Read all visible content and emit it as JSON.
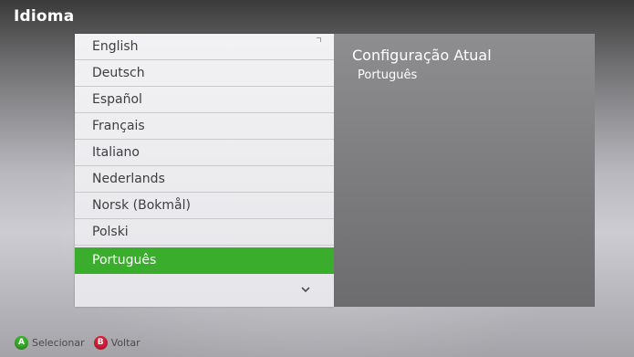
{
  "screen": {
    "title": "Idioma"
  },
  "language_list": {
    "items": [
      {
        "label": "English",
        "selected": false
      },
      {
        "label": "Deutsch",
        "selected": false
      },
      {
        "label": "Español",
        "selected": false
      },
      {
        "label": "Français",
        "selected": false
      },
      {
        "label": "Italiano",
        "selected": false
      },
      {
        "label": "Nederlands",
        "selected": false
      },
      {
        "label": "Norsk (Bokmål)",
        "selected": false
      },
      {
        "label": "Polski",
        "selected": false
      },
      {
        "label": "Português",
        "selected": true
      }
    ],
    "more_icon": "chevron-down-icon"
  },
  "current_setting": {
    "title": "Configuração Atual",
    "value": "Português"
  },
  "footer": {
    "select": {
      "button": "A",
      "label": "Selecionar",
      "color": "#3aad2c"
    },
    "back": {
      "button": "B",
      "label": "Voltar",
      "color": "#d6213a"
    }
  },
  "colors": {
    "highlight": "#3aad2c",
    "list_background": "#eeeef1",
    "info_background": "#7f7f81"
  }
}
